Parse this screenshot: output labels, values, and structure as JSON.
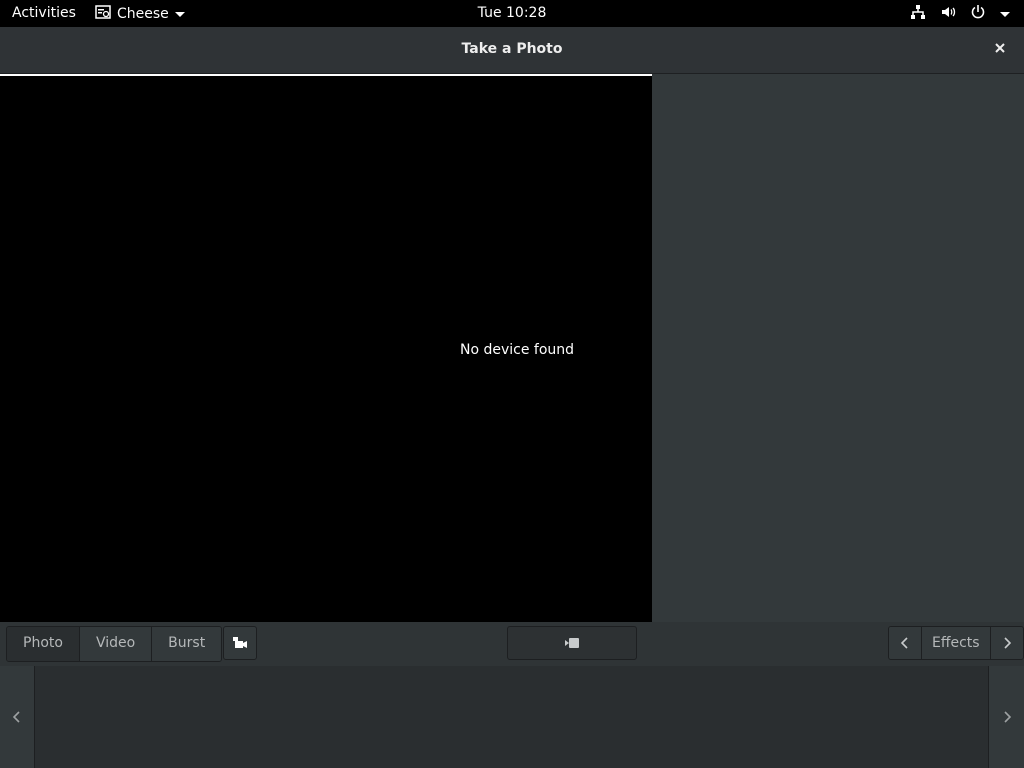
{
  "topbar": {
    "activities": "Activities",
    "app_name": "Cheese",
    "clock": "Tue 10:28",
    "icons": [
      "network-icon",
      "volume-icon",
      "power-icon",
      "chevron-down-icon"
    ]
  },
  "window": {
    "title": "Take a Photo",
    "close_icon": "close-icon"
  },
  "viewport": {
    "message": "No device found"
  },
  "toolbar": {
    "modes": [
      {
        "label": "Photo",
        "active": true
      },
      {
        "label": "Video",
        "active": false
      },
      {
        "label": "Burst",
        "active": false
      }
    ],
    "camera_switch_icon": "camera-switch-icon",
    "shutter_icon": "take-photo-icon",
    "effects_label": "Effects"
  },
  "colors": {
    "panel_bg": "#33393b",
    "viewport_bg": "#000000",
    "topbar_bg": "#000000",
    "text": "#b5b8b9"
  }
}
